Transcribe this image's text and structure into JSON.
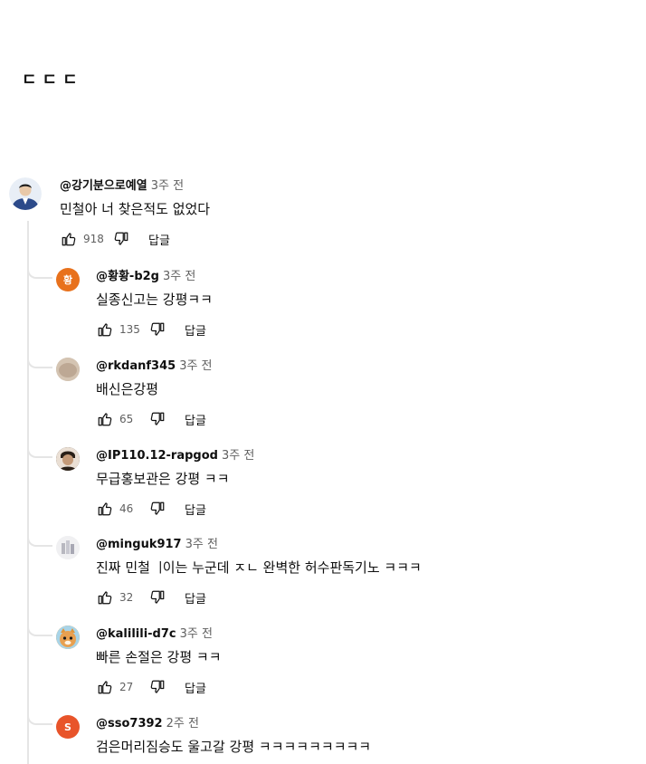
{
  "header": {
    "text": "ㄷㄷㄷ"
  },
  "top_comment": {
    "handle": "@강기분으로예열",
    "time": "3주 전",
    "text": "민철아 너 찾은적도 없었다",
    "likes": "918",
    "reply_label": "답글",
    "avatar_color": "#2c4a8a"
  },
  "replies": [
    {
      "handle": "@황황-b2g",
      "time": "3주 전",
      "text": "실종신고는 강평ㅋㅋ",
      "likes": "135",
      "reply_label": "답글",
      "avatar_letter": "황",
      "avatar_color": "#e8711c"
    },
    {
      "handle": "@rkdanf345",
      "time": "3주 전",
      "text": "배신은강평",
      "likes": "65",
      "reply_label": "답글",
      "avatar_letter": "",
      "avatar_color": "#c8b8a8"
    },
    {
      "handle": "@IP110.12-rapgod",
      "time": "3주 전",
      "text": "무급홍보관은 강평 ㅋㅋ",
      "likes": "46",
      "reply_label": "답글",
      "avatar_letter": "",
      "avatar_color": "#6b5a4a"
    },
    {
      "handle": "@minguk917",
      "time": "3주 전",
      "text": "진짜 민철ᅟᅵ이는 누군데 ㅈㄴ 완벽한 허수판독기노 ㅋㅋㅋ",
      "likes": "32",
      "reply_label": "답글",
      "avatar_letter": "",
      "avatar_color": "#d8d8dc"
    },
    {
      "handle": "@kalilili-d7c",
      "time": "3주 전",
      "text": "빠른 손절은 강평 ㅋㅋ",
      "likes": "27",
      "reply_label": "답글",
      "avatar_letter": "",
      "avatar_color": "#e0963c"
    },
    {
      "handle": "@sso7392",
      "time": "2주 전",
      "text": "검은머리짐승도 울고갈 강평 ㅋㅋㅋㅋㅋㅋㅋㅋㅋ",
      "likes": "",
      "reply_label": "",
      "avatar_letter": "S",
      "avatar_color": "#e8542a"
    }
  ]
}
